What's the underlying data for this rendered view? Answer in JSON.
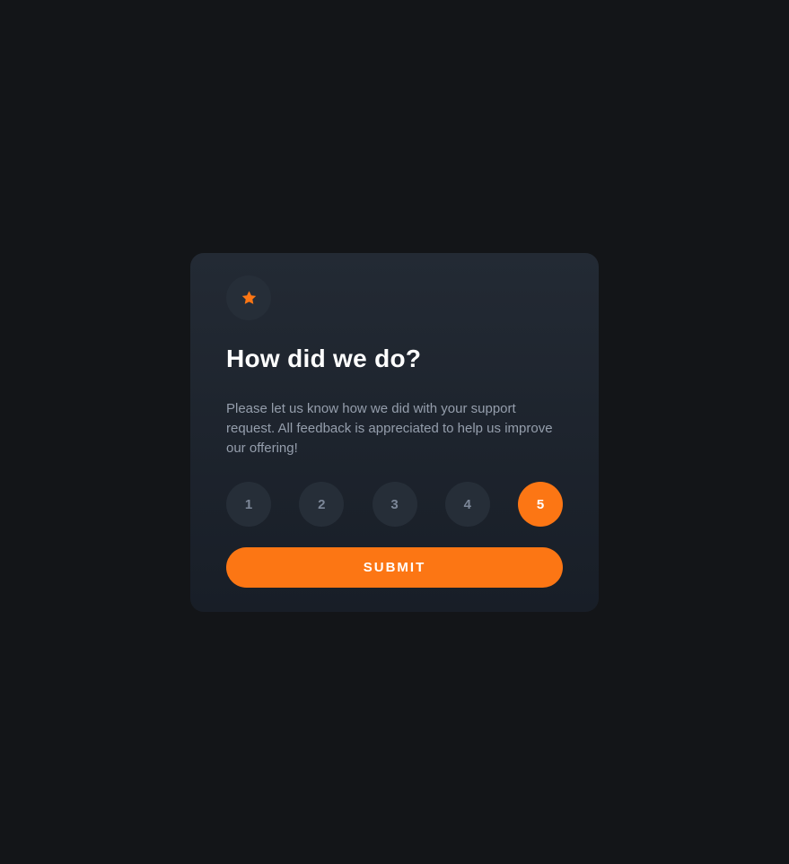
{
  "card": {
    "icon": "star-icon",
    "title": "How did we do?",
    "description": "Please let us know how we did with your support request. All feedback is appreciated to help us improve our offering!",
    "ratings": [
      {
        "label": "1",
        "selected": false
      },
      {
        "label": "2",
        "selected": false
      },
      {
        "label": "3",
        "selected": false
      },
      {
        "label": "4",
        "selected": false
      },
      {
        "label": "5",
        "selected": true
      }
    ],
    "submit_label": "SUBMIT"
  },
  "colors": {
    "page_background": "#131518",
    "card_background": "#232a34",
    "accent": "#fc7614",
    "rating_background": "#262e38",
    "rating_text": "#7c8798",
    "description_text": "#959eac",
    "title_text": "#ffffff"
  }
}
